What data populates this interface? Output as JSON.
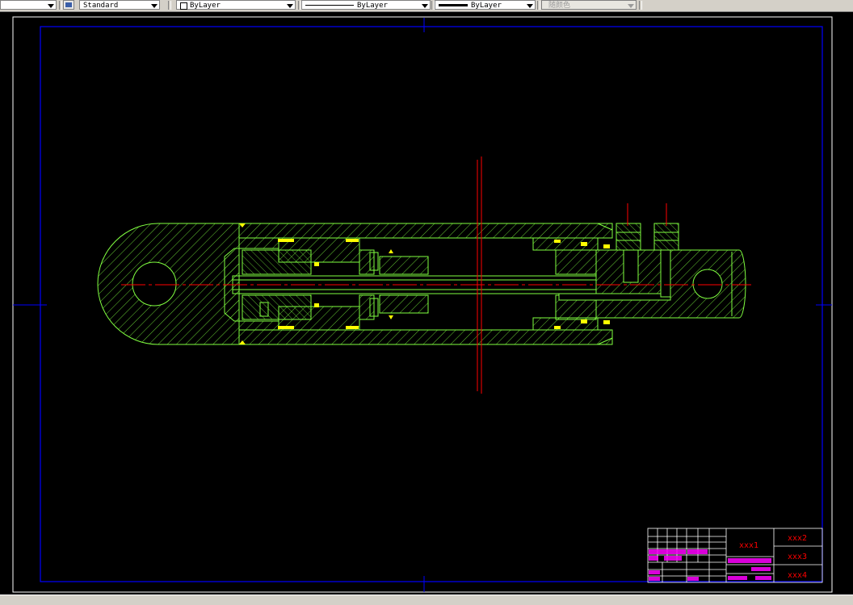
{
  "toolbar": {
    "text_style": "Standard",
    "layer": "ByLayer",
    "linetype": "ByLayer",
    "lineweight": "ByLayer",
    "color": "随颜色"
  },
  "title_block": {
    "cell_main": "xxx1",
    "cell_right_1": "xxx2",
    "cell_right_2": "xxx3",
    "cell_right_3": "xxx4"
  },
  "colors": {
    "background": "#000000",
    "frame": "#0000ff",
    "part_lines": "#80ff40",
    "center_lines": "#ff0000",
    "title_text": "#ff0000",
    "title_magenta": "#ff00ff",
    "markers": "#ffff00"
  },
  "icons": [
    "text-style-icon",
    "combo-arrow-icon",
    "color-swatch-icon"
  ]
}
